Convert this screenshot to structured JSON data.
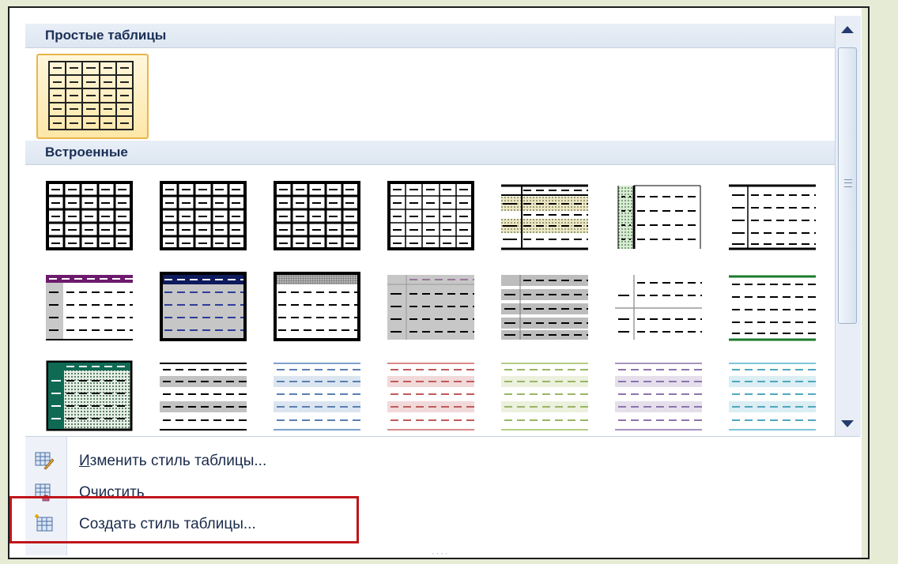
{
  "gallery": {
    "section_simple": "Простые таблицы",
    "section_builtin": "Встроенные"
  },
  "menu": {
    "modify_label": "Изменить стиль таблицы...",
    "modify_accesskey": "И",
    "clear_label": "Очистить",
    "clear_accesskey": "О",
    "new_label": "Создать стиль таблицы...",
    "new_accesskey": "д"
  },
  "icons": {
    "modify": "table-edit-icon",
    "clear": "table-clear-icon",
    "new": "table-new-icon",
    "scroll_up": "chevron-up-icon",
    "scroll_down": "chevron-down-icon"
  },
  "colors": {
    "highlight_box": "#c0151b",
    "selected_border": "#e8b64a",
    "header_text": "#1b2f55"
  }
}
